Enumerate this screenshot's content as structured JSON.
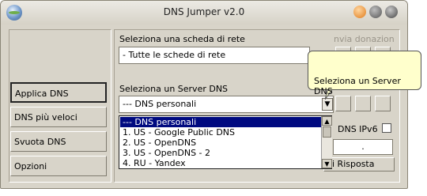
{
  "window": {
    "title": "DNS Jumper v2.0",
    "controls": [
      "minimize",
      "maximize",
      "close"
    ]
  },
  "sidebar": {
    "items": [
      {
        "label": "Applica DNS",
        "active": true
      },
      {
        "label": "DNS più veloci",
        "active": false
      },
      {
        "label": "Svuota DNS",
        "active": false
      },
      {
        "label": "Opzioni",
        "active": false
      }
    ]
  },
  "network": {
    "label": "Seleziona una scheda di rete",
    "value": "- Tutte le schede di rete"
  },
  "donation": {
    "label": "nvia donazion"
  },
  "dns_server": {
    "label": "Seleziona un Server DNS",
    "value": "--- DNS personali",
    "options": [
      "--- DNS personali",
      "1. US - Google Public DNS",
      "2. US - OpenDNS",
      "3. US - OpenDNS - 2",
      "4. RU - Yandex"
    ],
    "selected_index": 0
  },
  "tooltip": {
    "text": "Seleziona un Server DNS"
  },
  "ipv6": {
    "label": "DNS IPv6",
    "checked": false
  },
  "ip_field": {
    "value": "."
  },
  "response": {
    "label": "i Risposta"
  },
  "icons": {
    "app": "globe-icon",
    "dropdown_arrow": "chevron-down-icon",
    "scroll_up": "arrow-up-icon",
    "scroll_down": "arrow-down-icon"
  },
  "colors": {
    "window_bg": "#d8d4c9",
    "selection": "#000a80",
    "tooltip_bg": "#ffffcc",
    "minimize_button": "#e07b1a"
  }
}
